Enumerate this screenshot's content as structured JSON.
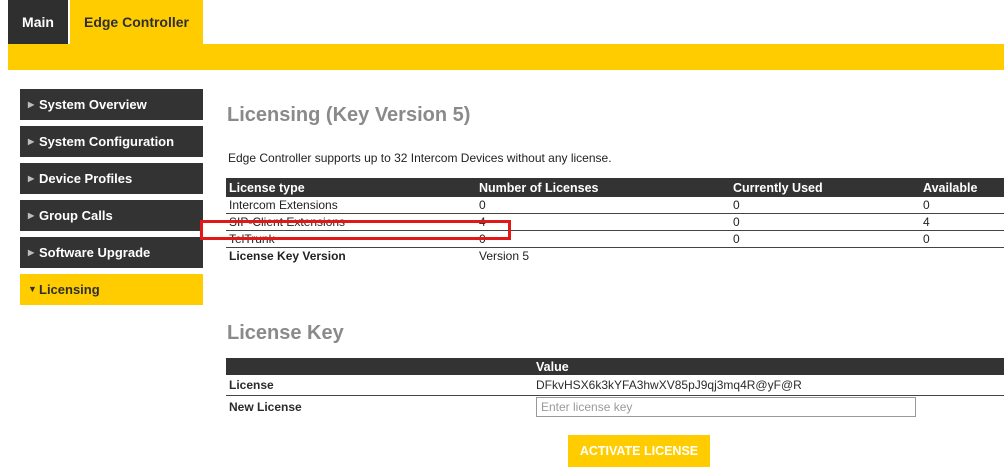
{
  "tabs": {
    "main": "Main",
    "edge": "Edge Controller"
  },
  "sidebar": {
    "items": [
      {
        "label": "System Overview"
      },
      {
        "label": "System Configuration"
      },
      {
        "label": "Device Profiles"
      },
      {
        "label": "Group Calls"
      },
      {
        "label": "Software Upgrade"
      },
      {
        "label": "Licensing"
      }
    ]
  },
  "licensing": {
    "title": "Licensing (Key Version 5)",
    "description": "Edge Controller supports up to 32 Intercom Devices without any license.",
    "headers": [
      "License type",
      "Number of Licenses",
      "Currently Used",
      "Available"
    ],
    "rows": [
      [
        "Intercom Extensions",
        "0",
        "0",
        "0"
      ],
      [
        "SIP-Client Extensions",
        "4",
        "0",
        "4"
      ],
      [
        "TelTrunk",
        "0",
        "0",
        "0"
      ]
    ],
    "key_version_label": "License Key Version",
    "key_version_value": "Version 5"
  },
  "license_key": {
    "title": "License Key",
    "value_header": "Value",
    "license_label": "License",
    "license_value": "DFkvHSX6k3kYFA3hwXV85pJ9qj3mq4R@yF@R",
    "new_label": "New License",
    "new_placeholder": "Enter license key",
    "new_value": ""
  },
  "activate_label": "ACTIVATE LICENSE",
  "colors": {
    "accent": "#ffcc00",
    "dark": "#333333",
    "highlight": "#e01818"
  }
}
